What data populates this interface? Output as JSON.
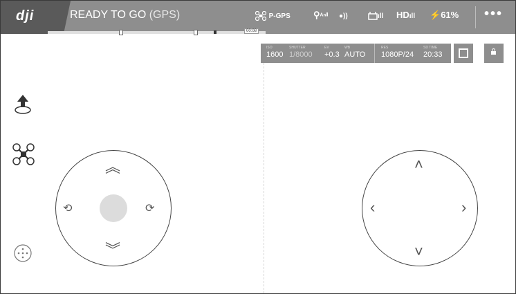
{
  "app": {
    "logo": "dji"
  },
  "status": {
    "title": "READY TO GO",
    "subtitle": "(GPS)"
  },
  "flight_mode": {
    "label": "P-GPS"
  },
  "signals": {
    "gps": "ᴬⁿˡˡ",
    "vision": "●))",
    "rc": "ıll",
    "hd": "HD",
    "battery": "61%"
  },
  "menu": {
    "more": "•••"
  },
  "progress_bar": {
    "safe_label": "00:08"
  },
  "camera": {
    "iso_label": "ISO",
    "iso": "1600",
    "shutter_label": "SHUTTER",
    "shutter": "1/8000",
    "ev_label": "EV",
    "ev": "+0.3",
    "wb_label": "WB",
    "wb": "AUTO",
    "res_label": "RES",
    "resolution": "1080P/24",
    "time_label": "SD TIME",
    "remaining": "20:33"
  },
  "controls": {
    "left_stick": {
      "up": "︽",
      "down": "︾",
      "rot_left": "⟲",
      "rot_right": "⟳"
    },
    "right_stick": {
      "up": "˄",
      "down": "˅",
      "left": "‹",
      "right": "›"
    }
  },
  "colors": {
    "bar": "#8e8e8e",
    "logo_bg": "#5a5a5a",
    "accent": "#ffffff"
  }
}
